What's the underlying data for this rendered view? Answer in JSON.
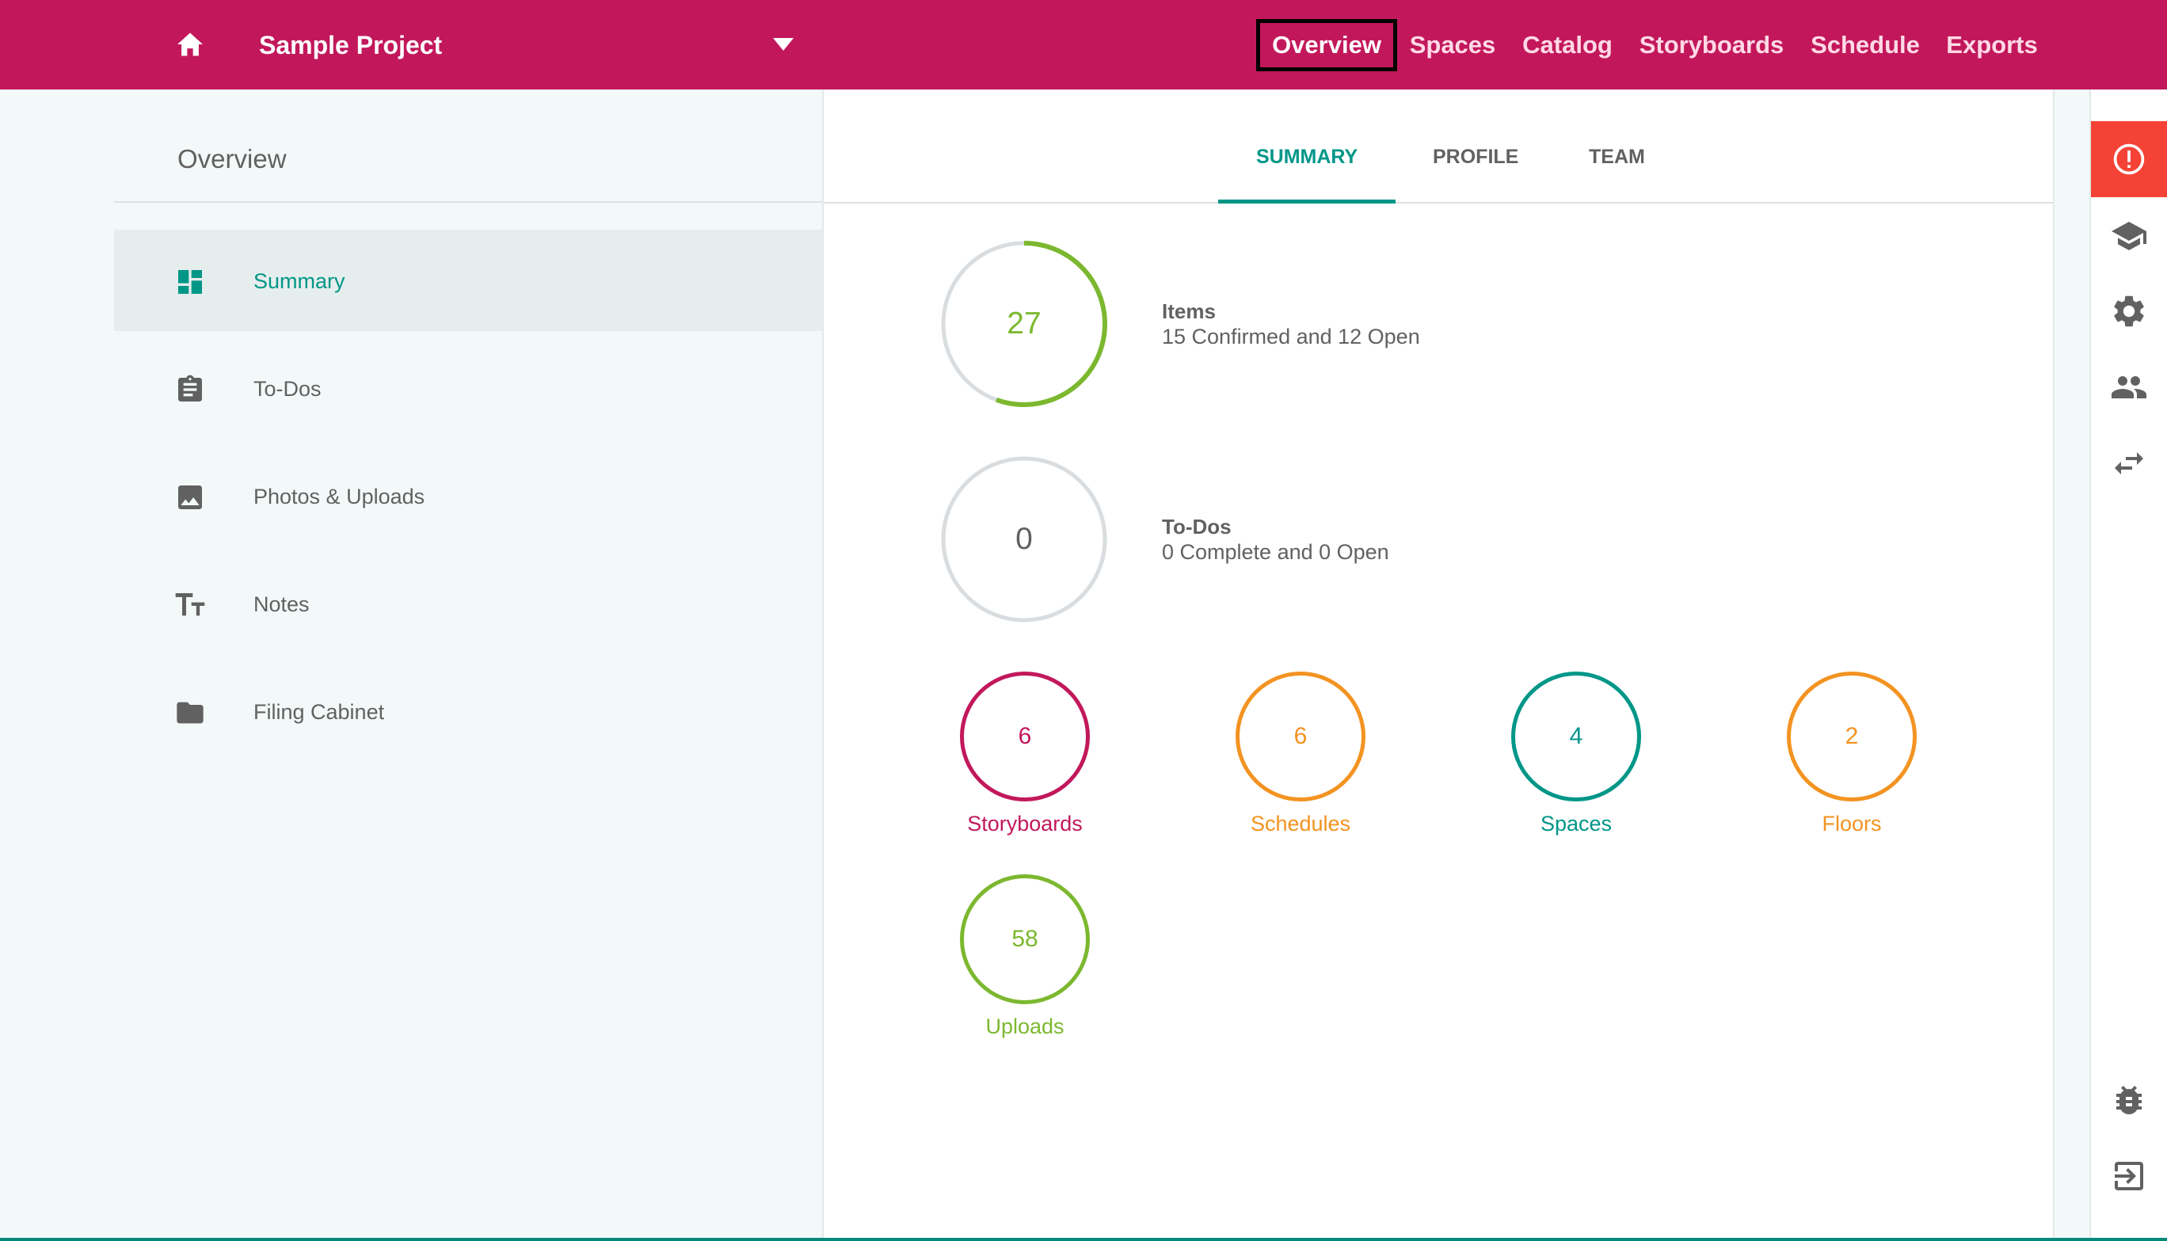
{
  "header": {
    "project_title": "Sample Project",
    "nav": [
      {
        "label": "Overview",
        "active": true
      },
      {
        "label": "Spaces"
      },
      {
        "label": "Catalog"
      },
      {
        "label": "Storyboards"
      },
      {
        "label": "Schedule"
      },
      {
        "label": "Exports"
      }
    ],
    "icons": [
      "home-icon",
      "dropdown-caret-icon"
    ]
  },
  "sidebar": {
    "title": "Overview",
    "items": [
      {
        "label": "Summary",
        "icon": "dashboard-icon",
        "active": true
      },
      {
        "label": "To-Dos",
        "icon": "clipboard-icon"
      },
      {
        "label": "Photos & Uploads",
        "icon": "image-icon"
      },
      {
        "label": "Notes",
        "icon": "text-size-icon"
      },
      {
        "label": "Filing Cabinet",
        "icon": "folder-icon"
      }
    ]
  },
  "tabs": [
    {
      "label": "SUMMARY",
      "active": true
    },
    {
      "label": "PROFILE"
    },
    {
      "label": "TEAM"
    }
  ],
  "stats": {
    "items": {
      "value": "27",
      "label": "Items",
      "detail": "15 Confirmed and 12 Open",
      "confirmed": 15,
      "open": 12
    },
    "todos": {
      "value": "0",
      "label": "To-Dos",
      "detail": "0 Complete and 0 Open"
    }
  },
  "counters": [
    {
      "value": "6",
      "label": "Storyboards",
      "color": "#c2185b"
    },
    {
      "value": "6",
      "label": "Schedules",
      "color": "#f39321"
    },
    {
      "value": "4",
      "label": "Spaces",
      "color": "#009688"
    },
    {
      "value": "2",
      "label": "Floors",
      "color": "#f39321"
    },
    {
      "value": "58",
      "label": "Uploads",
      "color": "#7cb82f"
    }
  ],
  "rail": {
    "icons": [
      "alert-icon",
      "graduation-cap-icon",
      "settings-icon",
      "people-icon",
      "swap-arrows-icon",
      "bug-icon",
      "exit-icon"
    ]
  },
  "colors": {
    "brand": "#c2185b",
    "accent": "#009688",
    "alert": "#f44336",
    "items_ring": "#7cb82f",
    "ring_track": "#d9dde0"
  }
}
